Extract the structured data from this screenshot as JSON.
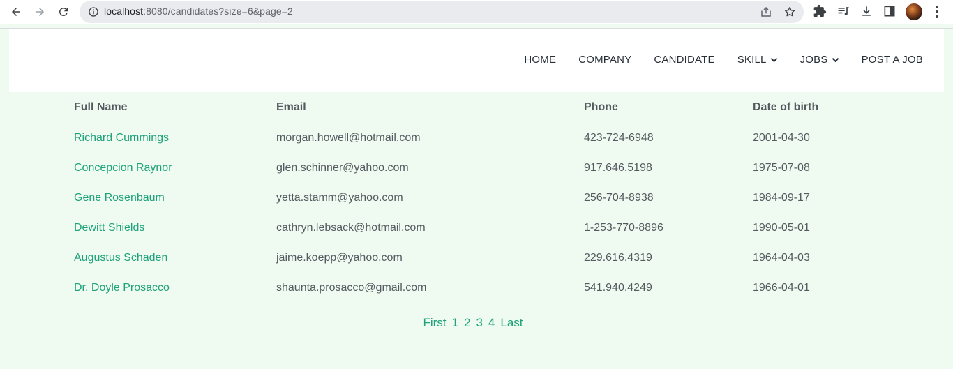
{
  "browser": {
    "url_host": "localhost",
    "url_rest": ":8080/candidates?size=6&page=2"
  },
  "nav": {
    "items": [
      {
        "label": "HOME",
        "dropdown": false
      },
      {
        "label": "COMPANY",
        "dropdown": false
      },
      {
        "label": "CANDIDATE",
        "dropdown": false
      },
      {
        "label": "SKILL",
        "dropdown": true
      },
      {
        "label": "JOBS",
        "dropdown": true
      },
      {
        "label": "POST A JOB",
        "dropdown": false
      }
    ]
  },
  "table": {
    "headers": [
      "Full Name",
      "Email",
      "Phone",
      "Date of birth"
    ],
    "rows": [
      [
        "Richard Cummings",
        "morgan.howell@hotmail.com",
        "423-724-6948",
        "2001-04-30"
      ],
      [
        "Concepcion Raynor",
        "glen.schinner@yahoo.com",
        "917.646.5198",
        "1975-07-08"
      ],
      [
        "Gene Rosenbaum",
        "yetta.stamm@yahoo.com",
        "256-704-8938",
        "1984-09-17"
      ],
      [
        "Dewitt Shields",
        "cathryn.lebsack@hotmail.com",
        "1-253-770-8896",
        "1990-05-01"
      ],
      [
        "Augustus Schaden",
        "jaime.koepp@yahoo.com",
        "229.616.4319",
        "1964-04-03"
      ],
      [
        "Dr. Doyle Prosacco",
        "shaunta.prosacco@gmail.com",
        "541.940.4249",
        "1966-04-01"
      ]
    ]
  },
  "pagination": {
    "first": "First",
    "pages": [
      "1",
      "2",
      "3",
      "4"
    ],
    "last": "Last"
  },
  "colors": {
    "accent": "#1ea27b",
    "background": "#effbf1",
    "text": "#555a60"
  },
  "icons": [
    "back-arrow-icon",
    "forward-arrow-icon",
    "reload-icon",
    "site-info-icon",
    "share-icon",
    "star-icon",
    "extensions-icon",
    "media-icon",
    "download-icon",
    "side-panel-icon",
    "chevron-down-icon"
  ]
}
